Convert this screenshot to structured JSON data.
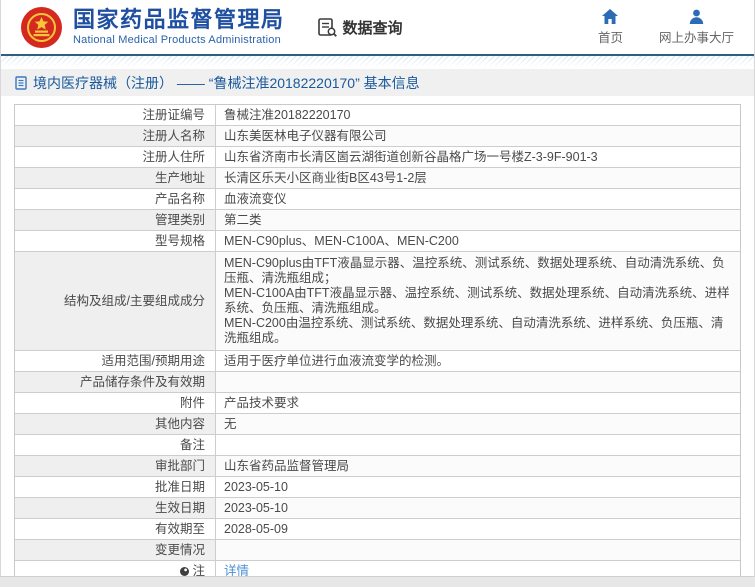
{
  "header": {
    "org_name_cn": "国家药品监督管理局",
    "org_name_en": "National Medical Products Administration",
    "data_query_label": "数据查询",
    "nav": {
      "home_label": "首页",
      "service_hall_label": "网上办事大厅"
    }
  },
  "breadcrumb": {
    "text": "境内医疗器械（注册） —— “鲁械注准20182220170” 基本信息"
  },
  "table": {
    "rows": [
      {
        "label": "注册证编号",
        "value": "鲁械注准20182220170"
      },
      {
        "label": "注册人名称",
        "value": "山东美医林电子仪器有限公司"
      },
      {
        "label": "注册人住所",
        "value": "山东省济南市长清区崮云湖街道创新谷晶格广场一号楼Z-3-9F-901-3"
      },
      {
        "label": "生产地址",
        "value": "长清区乐天小区商业街B区43号1-2层"
      },
      {
        "label": "产品名称",
        "value": "血液流变仪"
      },
      {
        "label": "管理类别",
        "value": "第二类"
      },
      {
        "label": "型号规格",
        "value": "MEN-C90plus、MEN-C100A、MEN-C200"
      },
      {
        "label": "结构及组成/主要组成成分",
        "value": "MEN-C90plus由TFT液晶显示器、温控系统、测试系统、数据处理系统、自动清洗系统、负压瓶、清洗瓶组成；\nMEN-C100A由TFT液晶显示器、温控系统、测试系统、数据处理系统、自动清洗系统、进样系统、负压瓶、清洗瓶组成。\nMEN-C200由温控系统、测试系统、数据处理系统、自动清洗系统、进样系统、负压瓶、清洗瓶组成。"
      },
      {
        "label": "适用范围/预期用途",
        "value": "适用于医疗单位进行血液流变学的检测。"
      },
      {
        "label": "产品储存条件及有效期",
        "value": ""
      },
      {
        "label": "附件",
        "value": "产品技术要求"
      },
      {
        "label": "其他内容",
        "value": "无"
      },
      {
        "label": "备注",
        "value": ""
      },
      {
        "label": "审批部门",
        "value": "山东省药品监督管理局"
      },
      {
        "label": "批准日期",
        "value": "2023-05-10"
      },
      {
        "label": "生效日期",
        "value": "2023-05-10"
      },
      {
        "label": "有效期至",
        "value": "2028-05-09"
      },
      {
        "label": "变更情况",
        "value": ""
      },
      {
        "label": "注",
        "value": "详情"
      }
    ]
  },
  "icons": {
    "logo": "national-emblem",
    "data_query": "document-magnifier",
    "home": "house",
    "service_hall": "person",
    "breadcrumb": "document",
    "note": "bulb"
  },
  "colors": {
    "brand_blue": "#1f4fa0",
    "breadcrumb_blue": "#19599d",
    "divider_line": "#2e5f80",
    "stripe_blue": "#cfe4f0",
    "link_blue": "#4a8fd4",
    "emblem_red": "#d5281e",
    "emblem_gold": "#f5c63c",
    "row_alt_bg": "#efefef",
    "border_gray": "#cdcdcd",
    "text_gray": "#4a4a4a"
  }
}
